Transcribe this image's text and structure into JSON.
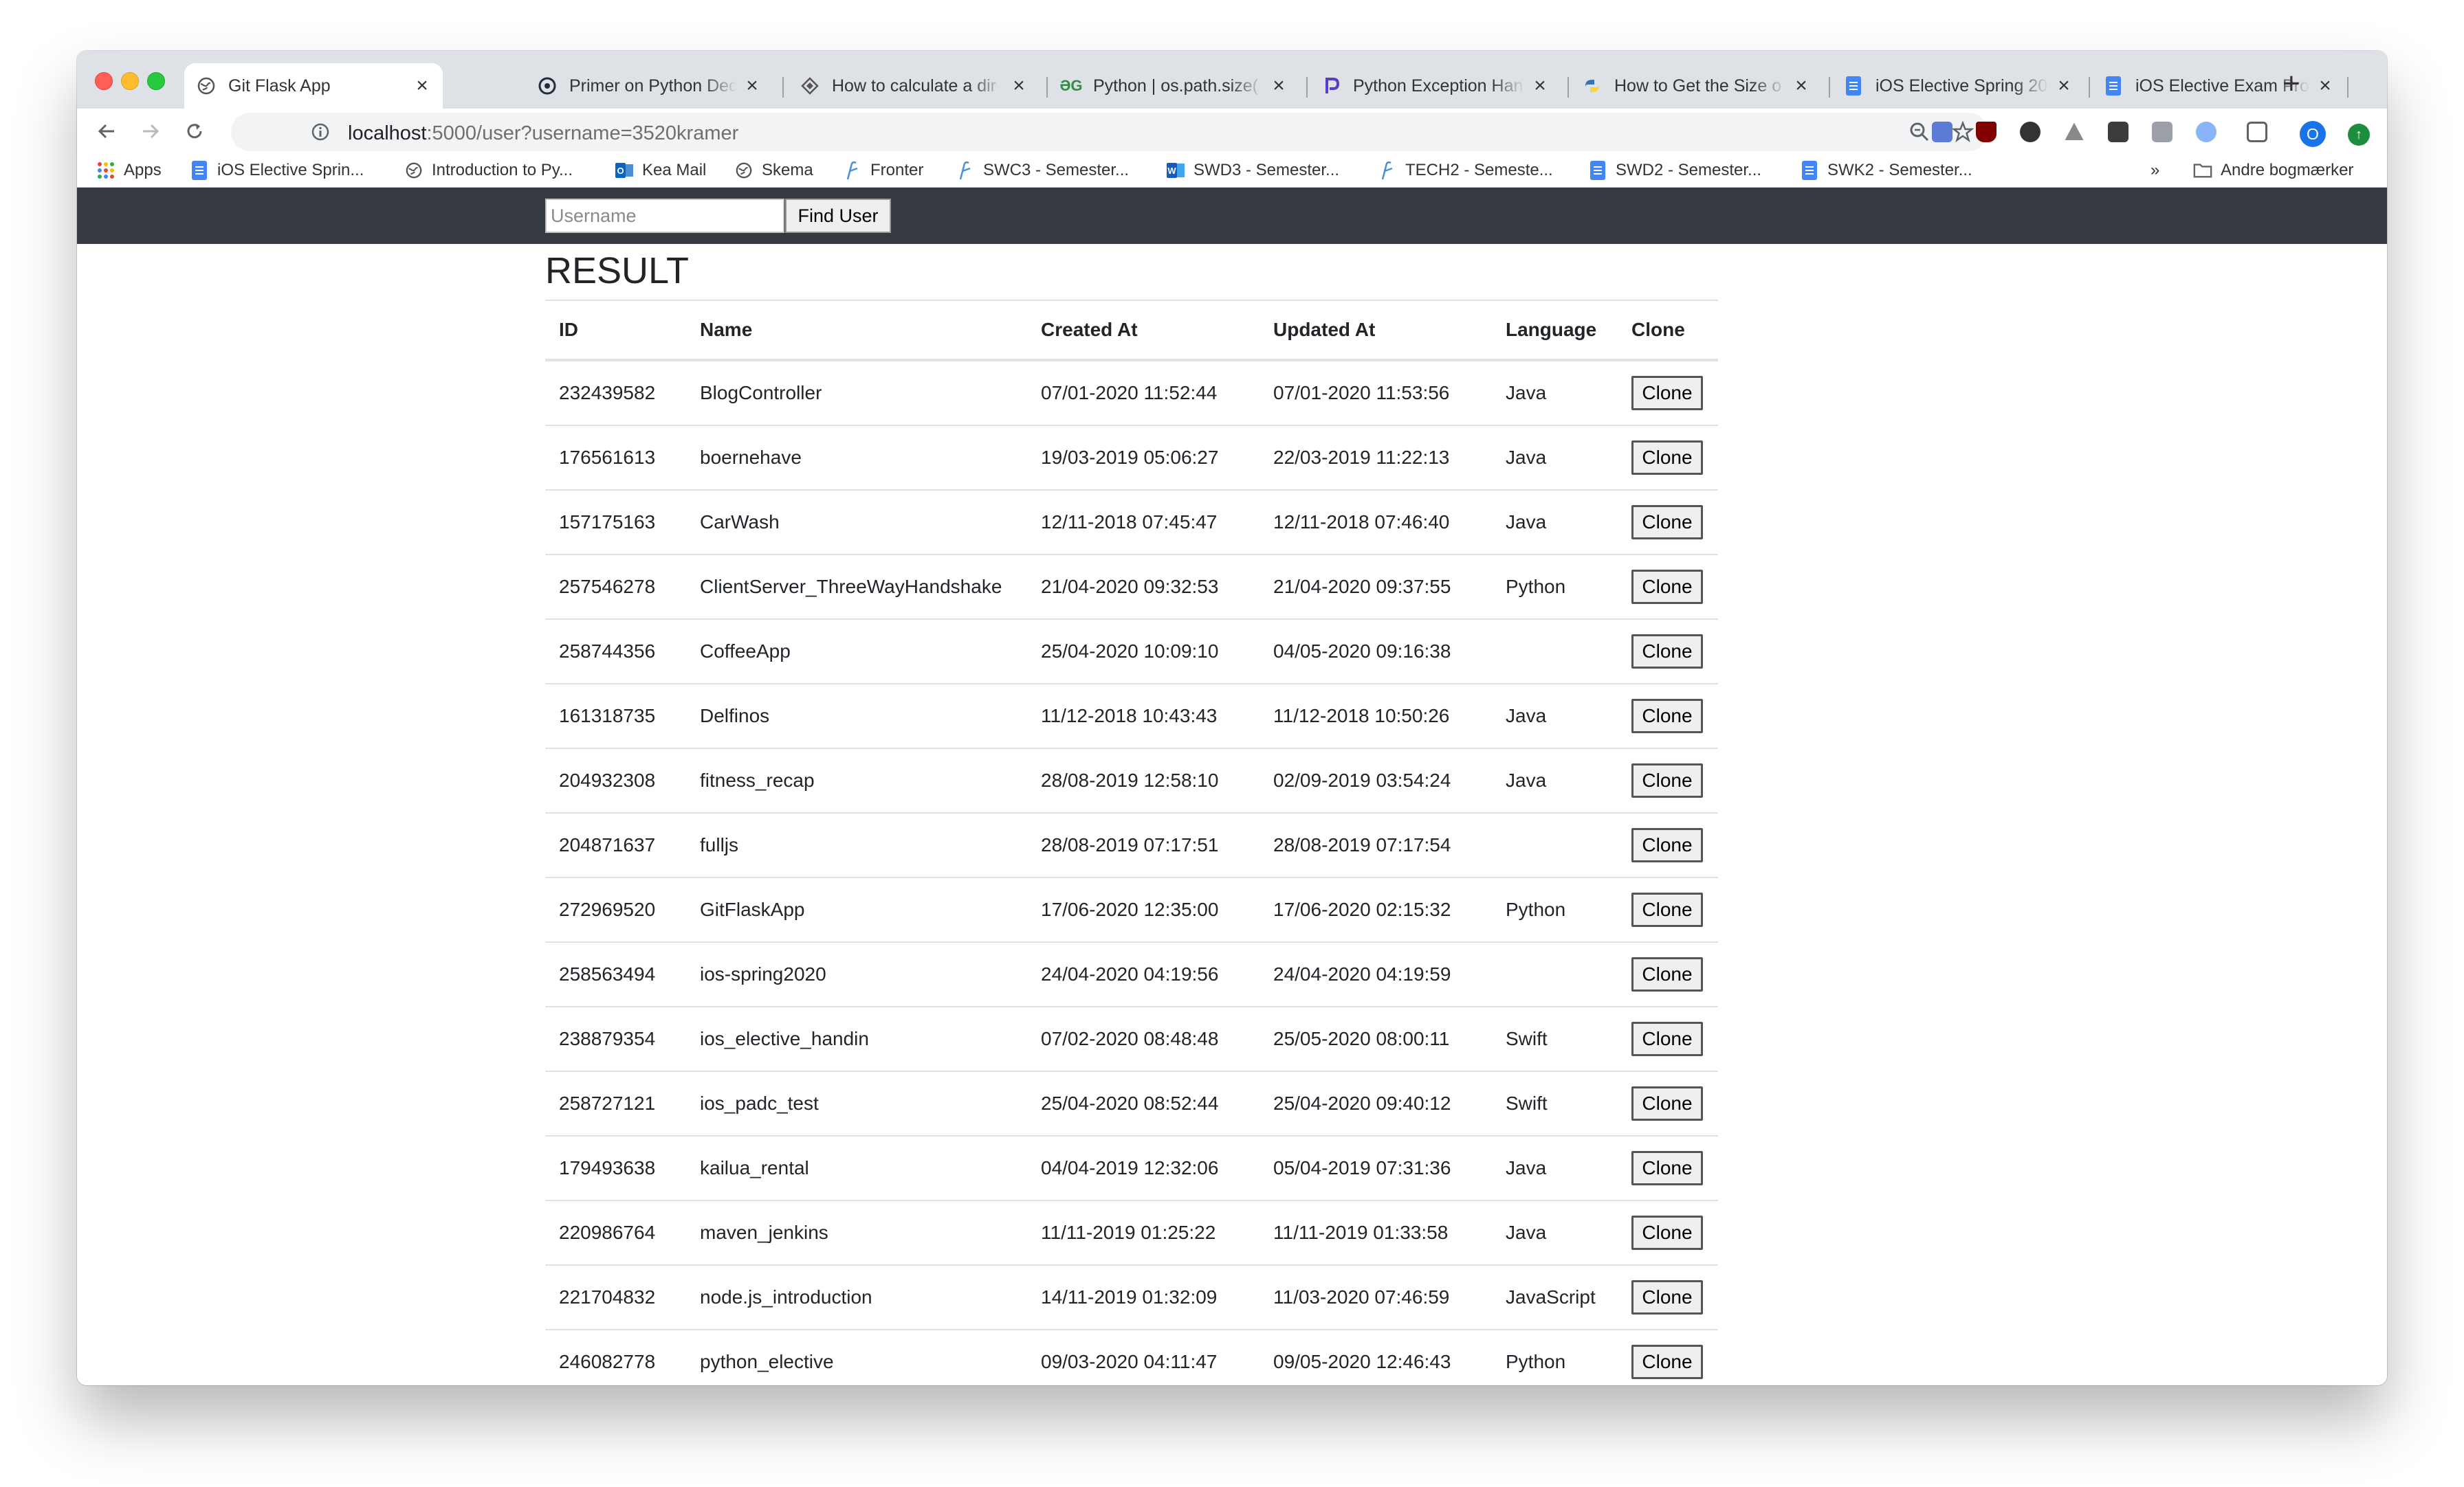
{
  "browser": {
    "tabs": [
      {
        "title": "Git Flask App",
        "icon": "globe-icon",
        "active": true
      },
      {
        "title": "Primer on Python Dec",
        "icon": "realpython-icon",
        "active": false
      },
      {
        "title": "How to calculate a dir",
        "icon": "diamond-icon",
        "active": false
      },
      {
        "title": "Python | os.path.size(",
        "icon": "geeksforgeeks-icon",
        "active": false
      },
      {
        "title": "Python Exception Han",
        "icon": "p-logo-icon",
        "active": false
      },
      {
        "title": "How to Get the Size o",
        "icon": "python-icon",
        "active": false
      },
      {
        "title": "iOS Elective Spring 20",
        "icon": "google-docs-icon",
        "active": false
      },
      {
        "title": "iOS Elective Exam Pro",
        "icon": "google-docs-icon",
        "active": false
      }
    ],
    "new_tab_label": "+",
    "url_host": "localhost",
    "url_rest": ":5000/user?username=3520kramer",
    "profile_initial": "O",
    "bookmarks": [
      {
        "label": "Apps",
        "icon": "apps-grid-icon"
      },
      {
        "label": "iOS Elective Sprin...",
        "icon": "google-docs-icon"
      },
      {
        "label": "Introduction to Py...",
        "icon": "globe-icon"
      },
      {
        "label": "Kea Mail",
        "icon": "outlook-icon"
      },
      {
        "label": "Skema",
        "icon": "globe-icon"
      },
      {
        "label": "Fronter",
        "icon": "fronter-icon"
      },
      {
        "label": "SWC3 - Semester...",
        "icon": "fronter-icon"
      },
      {
        "label": "SWD3 - Semester...",
        "icon": "word-icon"
      },
      {
        "label": "TECH2 - Semeste...",
        "icon": "fronter-icon"
      },
      {
        "label": "SWD2 - Semester...",
        "icon": "google-docs-icon"
      },
      {
        "label": "SWK2 - Semester...",
        "icon": "google-docs-icon"
      }
    ],
    "bookmarks_overflow": "»",
    "other_bookmarks": "Andre bogmærker",
    "accent_color": "#1a73e8"
  },
  "page": {
    "search": {
      "placeholder": "Username",
      "value": ""
    },
    "find_button": "Find User",
    "result_title": "RESULT",
    "navbar_color": "#343a40",
    "columns": [
      "ID",
      "Name",
      "Created At",
      "Updated At",
      "Language",
      "Clone"
    ],
    "clone_label": "Clone",
    "rows": [
      {
        "id": "232439582",
        "name": "BlogController",
        "created": "07/01-2020 11:52:44",
        "updated": "07/01-2020 11:53:56",
        "language": "Java"
      },
      {
        "id": "176561613",
        "name": "boernehave",
        "created": "19/03-2019 05:06:27",
        "updated": "22/03-2019 11:22:13",
        "language": "Java"
      },
      {
        "id": "157175163",
        "name": "CarWash",
        "created": "12/11-2018 07:45:47",
        "updated": "12/11-2018 07:46:40",
        "language": "Java"
      },
      {
        "id": "257546278",
        "name": "ClientServer_ThreeWayHandshake",
        "created": "21/04-2020 09:32:53",
        "updated": "21/04-2020 09:37:55",
        "language": "Python"
      },
      {
        "id": "258744356",
        "name": "CoffeeApp",
        "created": "25/04-2020 10:09:10",
        "updated": "04/05-2020 09:16:38",
        "language": ""
      },
      {
        "id": "161318735",
        "name": "Delfinos",
        "created": "11/12-2018 10:43:43",
        "updated": "11/12-2018 10:50:26",
        "language": "Java"
      },
      {
        "id": "204932308",
        "name": "fitness_recap",
        "created": "28/08-2019 12:58:10",
        "updated": "02/09-2019 03:54:24",
        "language": "Java"
      },
      {
        "id": "204871637",
        "name": "fulljs",
        "created": "28/08-2019 07:17:51",
        "updated": "28/08-2019 07:17:54",
        "language": ""
      },
      {
        "id": "272969520",
        "name": "GitFlaskApp",
        "created": "17/06-2020 12:35:00",
        "updated": "17/06-2020 02:15:32",
        "language": "Python"
      },
      {
        "id": "258563494",
        "name": "ios-spring2020",
        "created": "24/04-2020 04:19:56",
        "updated": "24/04-2020 04:19:59",
        "language": ""
      },
      {
        "id": "238879354",
        "name": "ios_elective_handin",
        "created": "07/02-2020 08:48:48",
        "updated": "25/05-2020 08:00:11",
        "language": "Swift"
      },
      {
        "id": "258727121",
        "name": "ios_padc_test",
        "created": "25/04-2020 08:52:44",
        "updated": "25/04-2020 09:40:12",
        "language": "Swift"
      },
      {
        "id": "179493638",
        "name": "kailua_rental",
        "created": "04/04-2019 12:32:06",
        "updated": "05/04-2019 07:31:36",
        "language": "Java"
      },
      {
        "id": "220986764",
        "name": "maven_jenkins",
        "created": "11/11-2019 01:25:22",
        "updated": "11/11-2019 01:33:58",
        "language": "Java"
      },
      {
        "id": "221704832",
        "name": "node.js_introduction",
        "created": "14/11-2019 01:32:09",
        "updated": "11/03-2020 07:46:59",
        "language": "JavaScript"
      },
      {
        "id": "246082778",
        "name": "python_elective",
        "created": "09/03-2020 04:11:47",
        "updated": "09/05-2020 12:46:43",
        "language": "Python"
      }
    ]
  }
}
